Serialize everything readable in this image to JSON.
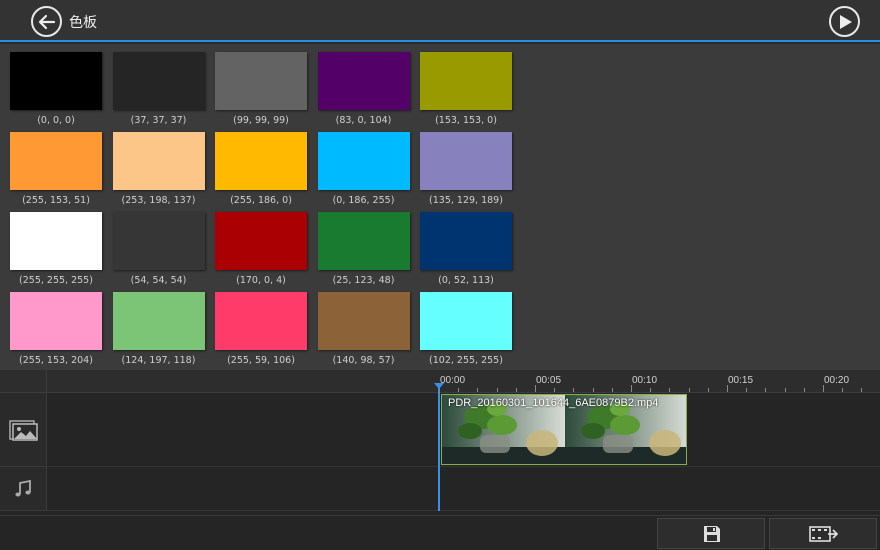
{
  "header": {
    "title": "色板",
    "back_icon": "back-arrow-icon",
    "play_icon": "play-icon",
    "accent": "#2a8fe0"
  },
  "palette": {
    "swatches": [
      {
        "label": "(0, 0, 0)",
        "color": "#000000"
      },
      {
        "label": "(37, 37, 37)",
        "color": "#252525"
      },
      {
        "label": "(99, 99, 99)",
        "color": "#636363"
      },
      {
        "label": "(83, 0, 104)",
        "color": "#530068"
      },
      {
        "label": "(153, 153, 0)",
        "color": "#999900"
      },
      {
        "label": "(255, 153, 51)",
        "color": "#ff9933"
      },
      {
        "label": "(253, 198, 137)",
        "color": "#fdc689"
      },
      {
        "label": "(255, 186, 0)",
        "color": "#ffba00"
      },
      {
        "label": "(0, 186, 255)",
        "color": "#00baff"
      },
      {
        "label": "(135, 129, 189)",
        "color": "#8781bd"
      },
      {
        "label": "(255, 255, 255)",
        "color": "#ffffff"
      },
      {
        "label": "(54, 54, 54)",
        "color": "#363636"
      },
      {
        "label": "(170, 0, 4)",
        "color": "#aa0004"
      },
      {
        "label": "(25, 123, 48)",
        "color": "#197b30"
      },
      {
        "label": "(0, 52, 113)",
        "color": "#003471"
      },
      {
        "label": "(255, 153, 204)",
        "color": "#ff99cc"
      },
      {
        "label": "(124, 197, 118)",
        "color": "#7cc576"
      },
      {
        "label": "(255, 59, 106)",
        "color": "#ff3b6a"
      },
      {
        "label": "(140, 98, 57)",
        "color": "#8c6239"
      },
      {
        "label": "(102, 255, 255)",
        "color": "#66ffff"
      }
    ]
  },
  "timeline": {
    "ticks": [
      "00:00",
      "00:05",
      "00:10",
      "00:15",
      "00:20"
    ],
    "video_track_icon": "image-video-track-icon",
    "audio_track_icon": "music-note-icon",
    "clip": {
      "filename": "PDR_20160301_101644_6AE0879B2.mp4"
    }
  },
  "bottom_bar": {
    "save_icon": "save-icon",
    "export_icon": "export-video-icon"
  }
}
